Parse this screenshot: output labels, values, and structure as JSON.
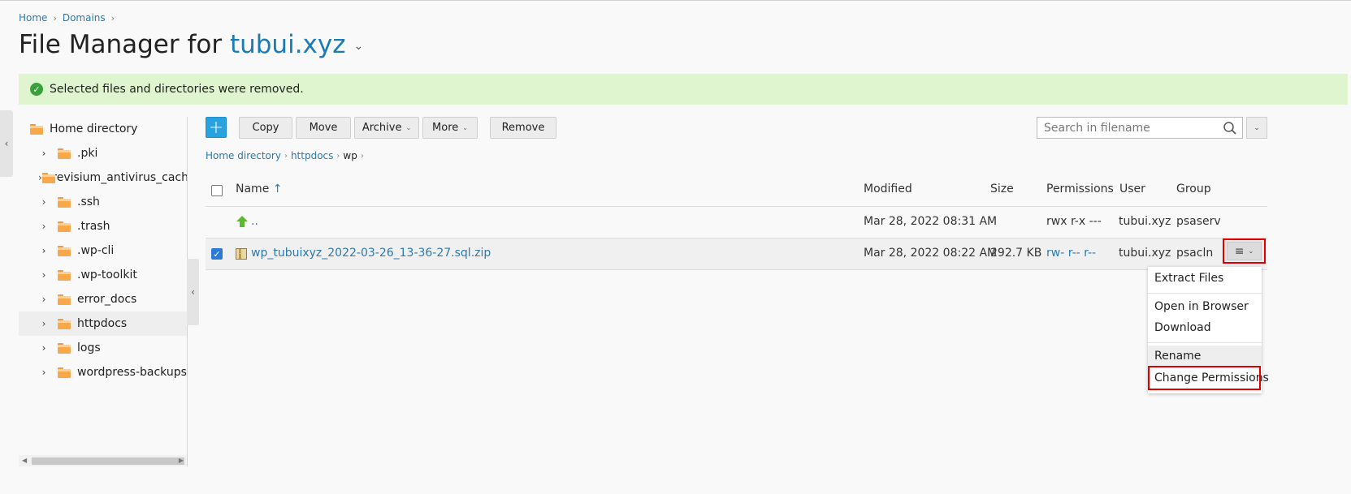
{
  "breadcrumb": {
    "items": [
      "Home",
      "Domains"
    ]
  },
  "page": {
    "title_prefix": "File Manager for ",
    "domain": "tubui.xyz"
  },
  "alert": {
    "message": "Selected files and directories were removed."
  },
  "tree": {
    "root": "Home directory",
    "items": [
      ".pki",
      ".revisium_antivirus_cach",
      ".ssh",
      ".trash",
      ".wp-cli",
      ".wp-toolkit",
      "error_docs",
      "httpdocs",
      "logs",
      "wordpress-backups"
    ],
    "selected": "httpdocs"
  },
  "toolbar": {
    "add_label": "+",
    "copy_label": "Copy",
    "move_label": "Move",
    "archive_label": "Archive",
    "more_label": "More",
    "remove_label": "Remove"
  },
  "search": {
    "placeholder": "Search in filename"
  },
  "path": {
    "items": [
      "Home directory",
      "httpdocs",
      "wp"
    ]
  },
  "table": {
    "headers": {
      "name": "Name",
      "name_sort": "↑",
      "modified": "Modified",
      "size": "Size",
      "permissions": "Permissions",
      "user": "User",
      "group": "Group"
    },
    "rows": [
      {
        "name": "..",
        "modified": "Mar 28, 2022 08:31 AM",
        "size": "",
        "permissions": "rwx r-x ---",
        "user": "tubui.xyz",
        "group": "psaserv"
      },
      {
        "name": "wp_tubuixyz_2022-03-26_13-36-27.sql.zip",
        "modified": "Mar 28, 2022 08:22 AM",
        "size": "292.7 KB",
        "permissions": "rw- r-- r--",
        "user": "tubui.xyz",
        "group": "psacln",
        "checked": true
      }
    ]
  },
  "context_menu": {
    "items": [
      "Extract Files",
      "Open in Browser",
      "Download",
      "Rename",
      "Change Permissions"
    ]
  },
  "colors": {
    "accent": "#1c7bb5",
    "alert_bg": "#dff5d0",
    "highlight": "#e00000",
    "add_button": "#29a3e0"
  }
}
